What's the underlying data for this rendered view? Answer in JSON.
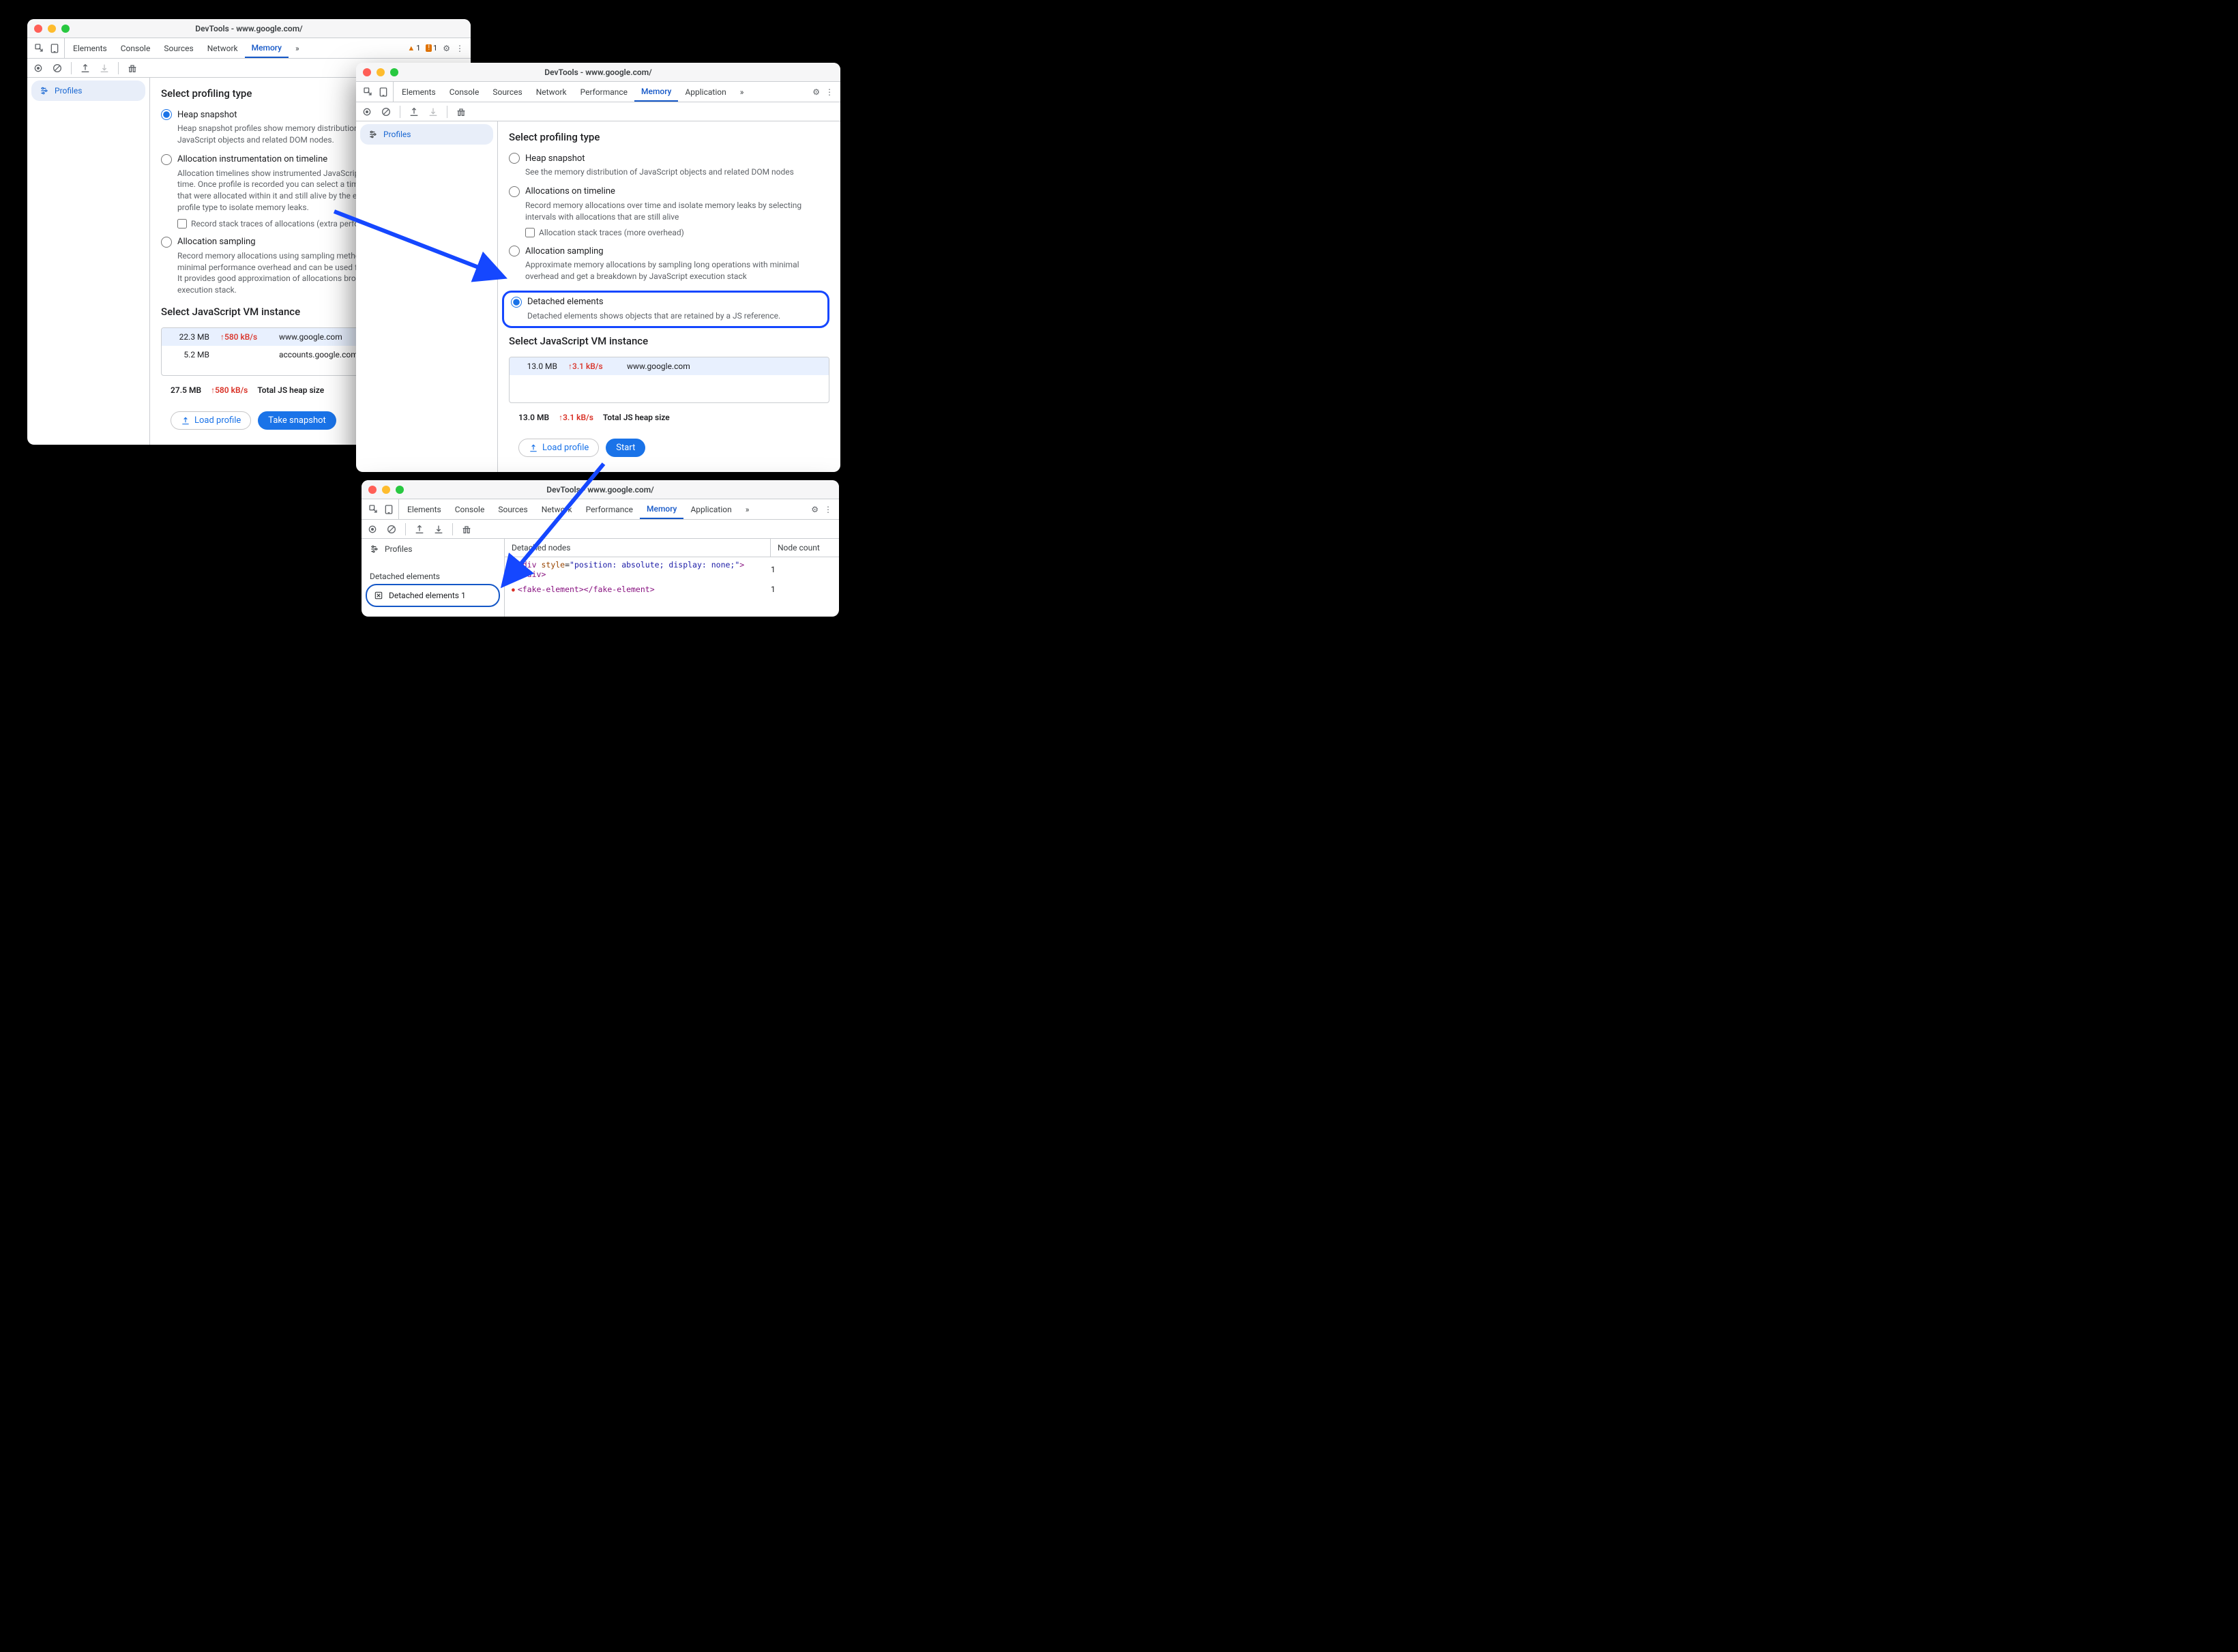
{
  "window1": {
    "title": "DevTools - www.google.com/",
    "tabs": [
      "Elements",
      "Console",
      "Sources",
      "Network",
      "Memory"
    ],
    "active_tab": "Memory",
    "more": "»",
    "warnings": {
      "yellow": "1",
      "orange": "1"
    },
    "sidebar": {
      "profiles": "Profiles"
    },
    "heading": "Select profiling type",
    "opts": {
      "heap": {
        "label": "Heap snapshot",
        "desc": "Heap snapshot profiles show memory distribution among your page's JavaScript objects and related DOM nodes."
      },
      "timeline": {
        "label": "Allocation instrumentation on timeline",
        "desc": "Allocation timelines show instrumented JavaScript memory allocations over time. Once profile is recorded you can select a time interval to see objects that were allocated within it and still alive by the end of recording. Use this profile type to isolate memory leaks.",
        "sub": "Record stack traces of allocations (extra performance overhead)"
      },
      "sampling": {
        "label": "Allocation sampling",
        "desc": "Record memory allocations using sampling method. This profile type has minimal performance overhead and can be used for long running operations. It provides good approximation of allocations broken down by JavaScript execution stack."
      }
    },
    "vm_heading": "Select JavaScript VM instance",
    "vm_rows": [
      {
        "size": "22.3 MB",
        "rate": "580 kB/s",
        "url": "www.google.com"
      },
      {
        "size": "5.2 MB",
        "rate": "",
        "url": "accounts.google.com: RotateCookiesPage"
      }
    ],
    "total": {
      "size": "27.5 MB",
      "rate": "580 kB/s",
      "label": "Total JS heap size"
    },
    "buttons": {
      "load": "Load profile",
      "action": "Take snapshot"
    }
  },
  "window2": {
    "title": "DevTools - www.google.com/",
    "tabs": [
      "Elements",
      "Console",
      "Sources",
      "Network",
      "Performance",
      "Memory",
      "Application"
    ],
    "active_tab": "Memory",
    "more": "»",
    "sidebar": {
      "profiles": "Profiles"
    },
    "heading": "Select profiling type",
    "opts": {
      "heap": {
        "label": "Heap snapshot",
        "desc": "See the memory distribution of JavaScript objects and related DOM nodes"
      },
      "timeline": {
        "label": "Allocations on timeline",
        "desc": "Record memory allocations over time and isolate memory leaks by selecting intervals with allocations that are still alive",
        "sub": "Allocation stack traces (more overhead)"
      },
      "sampling": {
        "label": "Allocation sampling",
        "desc": "Approximate memory allocations by sampling long operations with minimal overhead and get a breakdown by JavaScript execution stack"
      },
      "detached": {
        "label": "Detached elements",
        "desc": "Detached elements shows objects that are retained by a JS reference."
      }
    },
    "vm_heading": "Select JavaScript VM instance",
    "vm_rows": [
      {
        "size": "13.0 MB",
        "rate": "3.1 kB/s",
        "url": "www.google.com"
      }
    ],
    "total": {
      "size": "13.0 MB",
      "rate": "3.1 kB/s",
      "label": "Total JS heap size"
    },
    "buttons": {
      "load": "Load profile",
      "action": "Start"
    }
  },
  "window3": {
    "title": "DevTools - www.google.com/",
    "tabs": [
      "Elements",
      "Console",
      "Sources",
      "Network",
      "Performance",
      "Memory",
      "Application"
    ],
    "active_tab": "Memory",
    "more": "»",
    "sidebar": {
      "profiles": "Profiles",
      "section": "Detached elements",
      "item": "Detached elements 1"
    },
    "table": {
      "cols": [
        "Detached nodes",
        "Node count"
      ],
      "rows": [
        {
          "html": "<div style=\"position: absolute; display: none;\"></div>",
          "count": "1"
        },
        {
          "html": "<fake-element></fake-element>",
          "count": "1"
        }
      ]
    }
  }
}
